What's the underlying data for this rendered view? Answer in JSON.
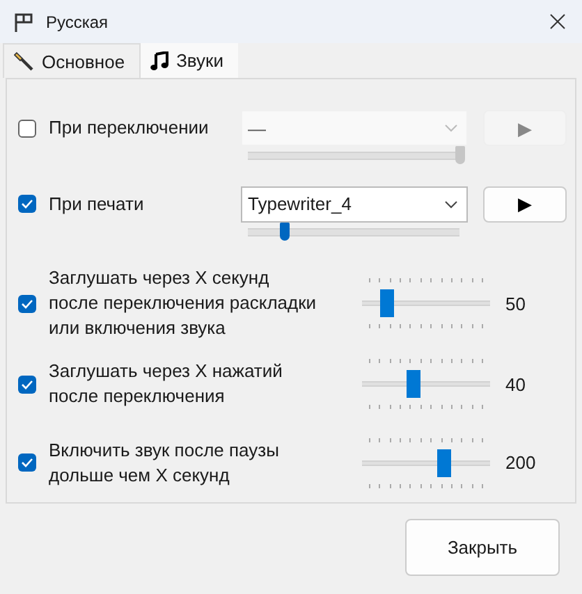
{
  "window": {
    "title": "Русская"
  },
  "tabs": [
    {
      "label": "Основное",
      "selected": false,
      "kind": "general"
    },
    {
      "label": "Звуки",
      "selected": true,
      "kind": "sounds"
    }
  ],
  "sound_events": [
    {
      "label": "При переключении",
      "checked": false,
      "sound": "—",
      "play": "▶",
      "level": 1.0
    },
    {
      "label": "При печати",
      "checked": true,
      "sound": "Typewriter_4",
      "play": "▶",
      "level": 0.17
    }
  ],
  "options": [
    {
      "label": "Заглушать через X секунд\nпосле переключения раскладки\nили включения звука",
      "checked": true,
      "level": 0.2,
      "value": "50"
    },
    {
      "label": "Заглушать через X нажатий\nпосле переключения",
      "checked": true,
      "level": 0.4,
      "value": "40"
    },
    {
      "label": "Включить звук после паузы\nдольше чем X секунд",
      "checked": true,
      "level": 0.64,
      "value": "200"
    }
  ],
  "buttons": [
    {
      "label": "Закрыть"
    }
  ]
}
